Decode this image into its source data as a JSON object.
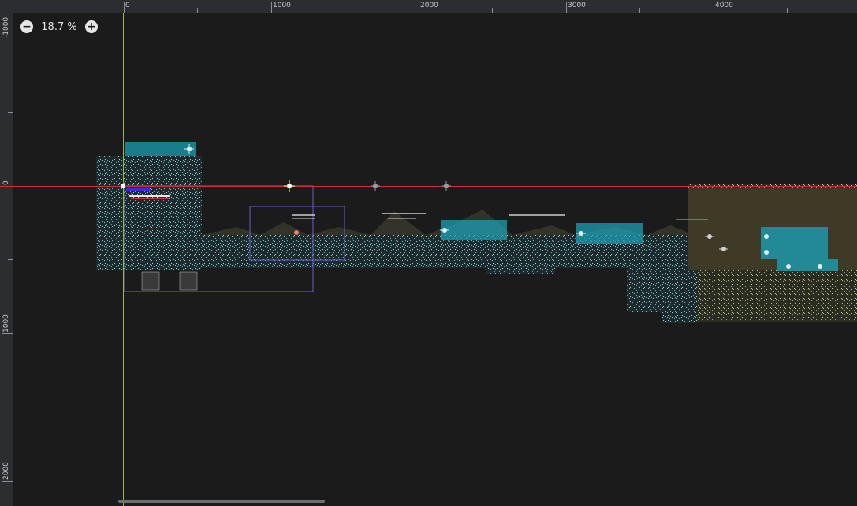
{
  "editor": {
    "zoom_label": "18.7 %",
    "zoom_out_icon": "minus-circle-icon",
    "zoom_in_icon": "plus-circle-icon"
  },
  "rulers": {
    "horizontal_labels": [
      "0",
      "1000",
      "2000",
      "3000",
      "4000"
    ],
    "vertical_labels": [
      "-1000",
      "0",
      "1000",
      "2000"
    ]
  },
  "colors": {
    "background": "#1b1b1b",
    "ruler": "#2b2d31",
    "x_axis": "#c8333b",
    "y_axis": "#9ab83a",
    "collision_shape": "#1aa6bc",
    "camera_rect": "#6a5fd6"
  }
}
